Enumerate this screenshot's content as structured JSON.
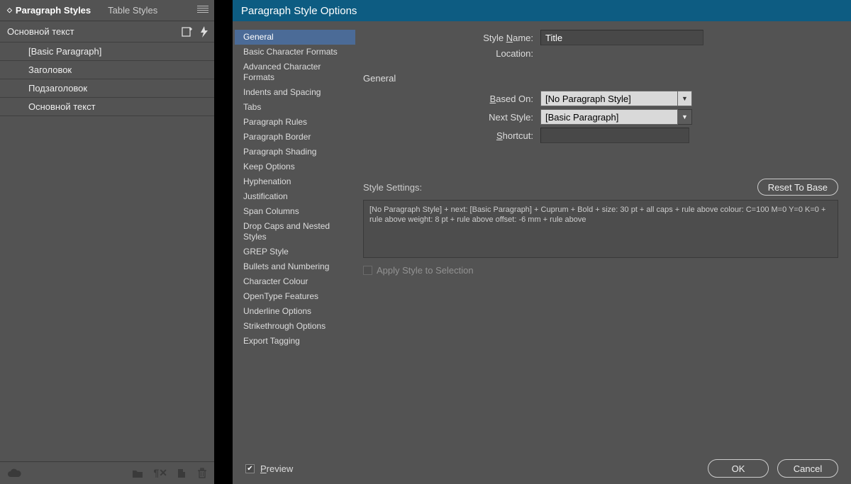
{
  "panel": {
    "tabs": [
      {
        "label": "Paragraph Styles",
        "active": true
      },
      {
        "label": "Table Styles",
        "active": false
      }
    ],
    "header_label": "Основной текст",
    "styles": [
      "[Basic Paragraph]",
      "Заголовок",
      "Подзаголовок",
      "Основной текст"
    ]
  },
  "dialog": {
    "title": "Paragraph Style Options",
    "categories": [
      "General",
      "Basic Character Formats",
      "Advanced Character Formats",
      "Indents and Spacing",
      "Tabs",
      "Paragraph Rules",
      "Paragraph Border",
      "Paragraph Shading",
      "Keep Options",
      "Hyphenation",
      "Justification",
      "Span Columns",
      "Drop Caps and Nested Styles",
      "GREP Style",
      "Bullets and Numbering",
      "Character Colour",
      "OpenType Features",
      "Underline Options",
      "Strikethrough Options",
      "Export Tagging"
    ],
    "selected_category": 0,
    "section_header": "General",
    "fields": {
      "style_name_label": "Style Name:",
      "style_name_value": "Title",
      "location_label": "Location:",
      "based_on_label": "Based On:",
      "based_on_value": "[No Paragraph Style]",
      "next_style_label": "Next Style:",
      "next_style_value": "[Basic Paragraph]",
      "shortcut_label": "Shortcut:",
      "shortcut_value": ""
    },
    "style_settings_label": "Style Settings:",
    "reset_label": "Reset To Base",
    "settings_text": "[No Paragraph Style] + next: [Basic Paragraph] + Cuprum + Bold + size: 30 pt + all caps + rule above colour: C=100 M=0 Y=0 K=0 + rule above weight: 8 pt + rule above offset: -6 mm + rule above",
    "apply_label": "Apply Style to Selection",
    "preview_label": "Preview",
    "ok_label": "OK",
    "cancel_label": "Cancel"
  }
}
